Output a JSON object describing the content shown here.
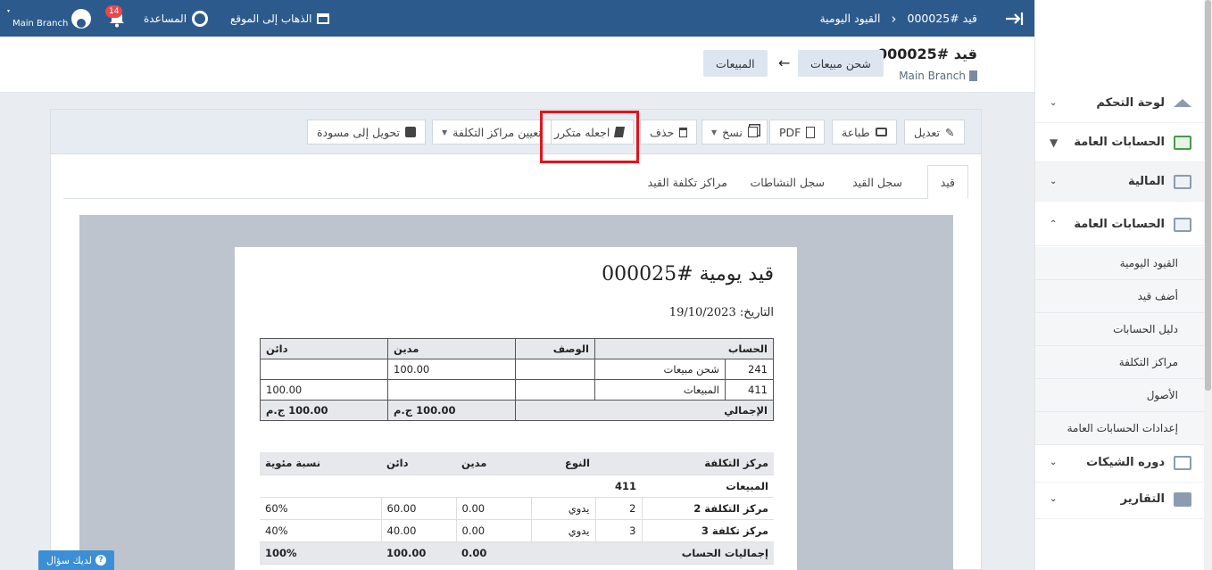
{
  "topbar": {
    "breadcrumb_parent": "القيود اليومية",
    "breadcrumb_sep": "›",
    "breadcrumb_current": "قيد #000025",
    "goto_site": "الذهاب إلى الموقع",
    "help": "المساعدة",
    "notif_count": "14",
    "branch": "Main Branch"
  },
  "header": {
    "title": "قيد #000025",
    "branch": "Main Branch",
    "chip_from": "شحن مبيعات",
    "arrow": "←",
    "chip_to": "المبيعات"
  },
  "toolbar": {
    "edit": "تعديل",
    "print": "طباعة",
    "pdf": "PDF",
    "copy": "نسخ",
    "delete": "حذف",
    "recurring": "اجعله متكرر",
    "cost_centers": "تعيين مراكز التكلفة",
    "to_draft": "تحويل إلى مسودة"
  },
  "tabs": [
    "قيد",
    "سجل القيد",
    "سجل النشاطات",
    "مراكز تكلفة القيد"
  ],
  "document": {
    "title": "قيد يومية #000025",
    "date": "التاريخ: 19/10/2023",
    "entries_headers": [
      "الحساب",
      "الوصف",
      "مدين",
      "دائن"
    ],
    "entries": [
      {
        "code": "241",
        "name": "شحن مبيعات",
        "desc": "",
        "debit": "100.00",
        "credit": ""
      },
      {
        "code": "411",
        "name": "المبيعات",
        "desc": "",
        "debit": "",
        "credit": "100.00"
      }
    ],
    "total_label": "الإجمالي",
    "total_debit": "100.00 ج.م",
    "total_credit": "100.00 ج.م",
    "cc_headers": [
      "مركز التكلفة",
      "النوع",
      "مدين",
      "دائن",
      "نسبة مئوية"
    ],
    "cc_account_name": "المبيعات",
    "cc_account_code": "411",
    "cc_rows": [
      {
        "name": "مركز التكلفة 2",
        "num": "2",
        "type": "يدوي",
        "debit": "0.00",
        "credit": "60.00",
        "pct": "60%"
      },
      {
        "name": "مركز تكلفة 3",
        "num": "3",
        "type": "يدوي",
        "debit": "0.00",
        "credit": "40.00",
        "pct": "40%"
      }
    ],
    "cc_total_label": "إجماليات الحساب",
    "cc_total_debit": "0.00",
    "cc_total_credit": "100.00",
    "cc_total_pct": "100%"
  },
  "sidebar": {
    "dashboard": "لوحة التحكم",
    "general_accounts_1": "الحسابات العامة",
    "finance": "المالية",
    "general_accounts_2": "الحسابات العامة",
    "sub_items": [
      "القيود اليومية",
      "أضف قيد",
      "دليل الحسابات",
      "مراكز التكلفة",
      "الأصول",
      "إعدادات الحسابات العامة"
    ],
    "cheques": "دوره الشيكات",
    "reports": "التقارير"
  },
  "help_button": "لديك سؤال"
}
